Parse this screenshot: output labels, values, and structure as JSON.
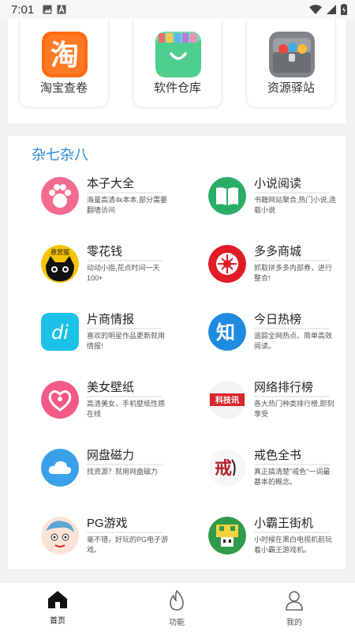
{
  "status_bar": {
    "time": "7:01"
  },
  "top_tiles": [
    {
      "label": "淘宝查卷",
      "icon": "taobao-icon"
    },
    {
      "label": "软件仓库",
      "icon": "shopping-bag-icon"
    },
    {
      "label": "资源驿站",
      "icon": "treasure-chest-icon"
    }
  ],
  "section": {
    "title": "杂七杂八"
  },
  "items": [
    {
      "title": "本子大全",
      "desc": "海量高清4k本本,部分需要翻墙访问",
      "icon": "paw-icon"
    },
    {
      "title": "小说阅读",
      "desc": "书籍网站聚合,热门小说,连载小说",
      "icon": "book-icon"
    },
    {
      "title": "零花钱",
      "desc": "动动小指,花点时间一天100+",
      "icon": "cat-icon",
      "badge": "悬赏猫"
    },
    {
      "title": "多多商城",
      "desc": "抓取拼多多内部券，进行整合!",
      "icon": "pinduoduo-icon"
    },
    {
      "title": "片商情报",
      "desc": "喜欢的明星作品更新就用情报!",
      "icon": "di-icon",
      "badge": "di"
    },
    {
      "title": "今日热榜",
      "desc": "追踪全网热点、简单高效阅读。",
      "icon": "zhihu-icon",
      "badge": "知"
    },
    {
      "title": "美女壁纸",
      "desc": "高清美女，手机壁纸性感在线",
      "icon": "heart-icon"
    },
    {
      "title": "网络排行榜",
      "desc": "各大热门种类排行榜,即刻享受",
      "icon": "keji-icon",
      "badge": "科技讯"
    },
    {
      "title": "网盘磁力",
      "desc": "找资源？就用网盘磁力",
      "icon": "cloud-icon"
    },
    {
      "title": "戒色全书",
      "desc": "真正搞清楚\"戒色\"一词最基本的概念。",
      "icon": "calligraphy-icon",
      "badge": "戒"
    },
    {
      "title": "PG游戏",
      "desc": "毫不错，好玩的PG电子游戏。",
      "icon": "cartoon-face-icon"
    },
    {
      "title": "小霸王街机",
      "desc": "小时候在黑白电视机前玩着小霸王游戏机。",
      "icon": "pixel-mushroom-icon"
    }
  ],
  "bottom_nav": [
    {
      "label": "首页",
      "icon": "home-icon",
      "active": true
    },
    {
      "label": "功能",
      "icon": "flame-icon",
      "active": false
    },
    {
      "label": "我的",
      "icon": "user-icon",
      "active": false
    }
  ],
  "colors": {
    "accent": "#2a8ad6",
    "taobao": "#ff6a14",
    "green": "#2aae67"
  }
}
